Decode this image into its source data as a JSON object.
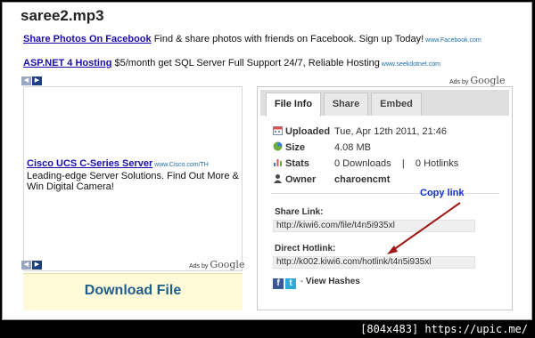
{
  "page": {
    "title": "saree2.mp3"
  },
  "ads": [
    {
      "link": "Share Photos On Facebook",
      "text": " Find & share photos with friends on Facebook. Sign up Today!",
      "url": " www.Facebook.com"
    },
    {
      "link": "ASP.NET 4 Hosting",
      "text": " $5/month get SQL Server Full Support 24/7, Reliable Hosting",
      "url": " www.seekdotnet.com"
    }
  ],
  "ads_by": {
    "prefix": "Ads by ",
    "brand": "Google"
  },
  "nav": {
    "prev": "◀",
    "next": "▶"
  },
  "cisco_ad": {
    "link": "Cisco UCS C-Series Server",
    "url": " www.Cisco.com/TH",
    "text": "Leading-edge Server Solutions. Find Out More & Win Digital Camera!"
  },
  "download": {
    "label": "Download File"
  },
  "tabs": [
    {
      "label": "File Info",
      "active": true
    },
    {
      "label": "Share",
      "active": false
    },
    {
      "label": "Embed",
      "active": false
    }
  ],
  "file_info": {
    "uploaded": {
      "label": "Uploaded",
      "value": "Tue, Apr 12th 2011, 21:46"
    },
    "size": {
      "label": "Size",
      "value": "4.08 MB"
    },
    "stats": {
      "label": "Stats",
      "value": "0 Downloads    |    0 Hotlinks"
    },
    "owner": {
      "label": "Owner",
      "value": "charoencmt"
    }
  },
  "share_link": {
    "label": "Share Link:",
    "value": "http://kiwi6.com/file/t4n5i935xl"
  },
  "direct_hotlink": {
    "label": "Direct Hotlink:",
    "value": "http://k002.kiwi6.com/hotlink/t4n5i935xl"
  },
  "annotation": {
    "text": "Copy link",
    "color": "#1230c9",
    "arrow_color": "#a01515"
  },
  "social": {
    "facebook": "f",
    "twitter": "t",
    "separator": " - ",
    "view_hashes": "View Hashes"
  },
  "watermark": "[804x483] https://upic.me/"
}
